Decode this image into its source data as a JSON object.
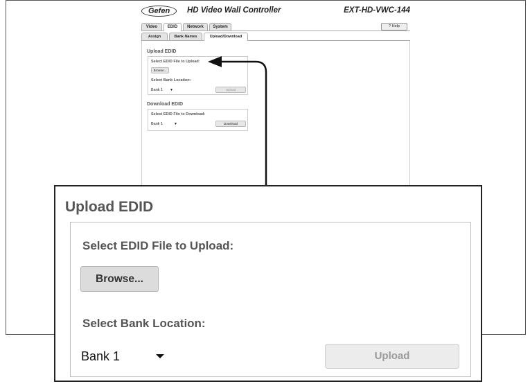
{
  "app": {
    "logo": "Gefen",
    "title": "HD Video Wall Controller",
    "model": "EXT-HD-VWC-144"
  },
  "main_tabs": [
    "Video",
    "EDID",
    "Network",
    "System"
  ],
  "help_label": "? Help",
  "sub_tabs": [
    "Assign",
    "Bank Names",
    "Upload/Download"
  ],
  "upload": {
    "title": "Upload EDID",
    "file_label": "Select EDID File to Upload:",
    "browse_label": "Browse...",
    "bank_label": "Select Bank Location:",
    "bank_value": "Bank 1",
    "upload_label": "Upload"
  },
  "download": {
    "title": "Download EDID",
    "file_label": "Select EDID File to Download:",
    "bank_value": "Bank 1",
    "download_label": "Download"
  }
}
